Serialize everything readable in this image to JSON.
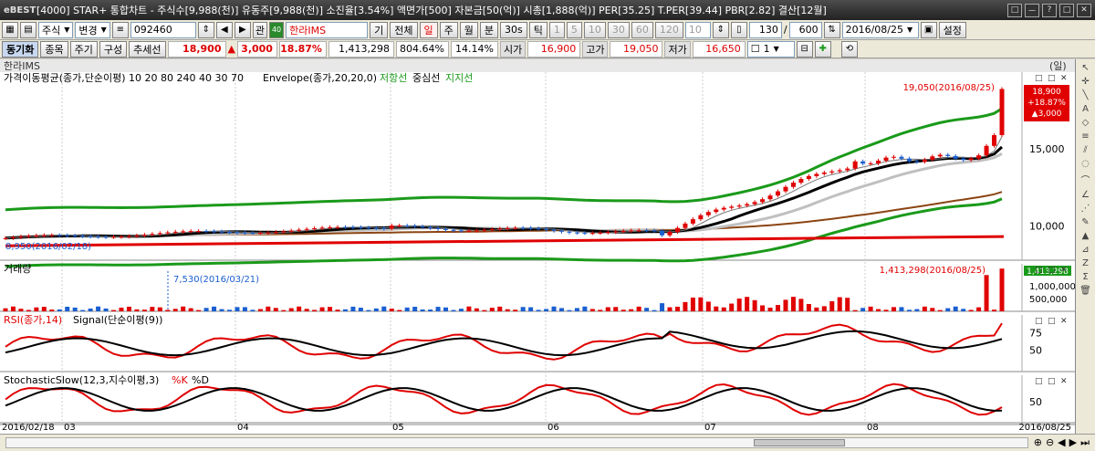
{
  "window": {
    "logo": "eBEST",
    "title": "[4000] STAR+ 통합차트 - 주식수[9,988(천)] 유동주[9,988(천)] 소진율[3.54%] 액면가[500] 자본금[50(억)] 시총[1,888(억)] PER[35.25] T.PER[39.44] PBR[2.82] 결산[12월]",
    "buttons": [
      "□",
      "ㅡ",
      "?",
      "□",
      "✕"
    ]
  },
  "toolbar1": {
    "market": "주식",
    "change": "변경",
    "code": "092460",
    "link": "관",
    "name": "한라IMS",
    "basis": "기",
    "all": "전체",
    "periods": [
      "일",
      "주",
      "월",
      "분",
      "30s",
      "틱"
    ],
    "nums": [
      "1",
      "5",
      "10",
      "30",
      "60",
      "120",
      "10"
    ],
    "count": "130",
    "count_total": "600",
    "date": "2016/08/25",
    "setting": "설정"
  },
  "toolbar2": {
    "sync": "동기화",
    "tab_item": "종목",
    "tab_period": "주기",
    "tab_config": "구성",
    "tab_trend": "추세선",
    "price": "18,900",
    "change_sign": "▲",
    "change": "3,000",
    "rate": "18.87%",
    "volume": "1,413,298",
    "vol_pct": "804.64%",
    "turnover": "14.14%",
    "open_label": "시가",
    "open": "16,900",
    "high_label": "고가",
    "high": "19,050",
    "low_label": "저가",
    "low": "16,650",
    "ratio": "1"
  },
  "chart": {
    "stock_name": "한라IMS",
    "unit": "(일)",
    "colors": {
      "up": "#e00000",
      "down": "#1a5fd0",
      "ma5": "#000000",
      "ma20": "#c0c0c0",
      "ma60": "#8b4513",
      "ma120": "#e00000",
      "envelope": "#1a9a1a",
      "rsi": "#e00000",
      "signal": "#000000"
    },
    "price_panel": {
      "legend": "가격이동평균(종가,단순이평) 10 20 80 240 40 30 70",
      "legend2": "Envelope(종가,20,20,0)",
      "env_low": "저항선",
      "env_mid": "중심선",
      "env_sup": "지지선",
      "high_marker": "19,050(2016/08/25)",
      "low_marker": "8,950(2016/02/18)",
      "last_price": "18,900",
      "last_rate": "+18.87%",
      "last_change": "▲3,000",
      "yticks": [
        "15,000",
        "10,000"
      ]
    },
    "volume_panel": {
      "legend": "거래량",
      "max_marker": "1,413,298(2016/08/25)",
      "min_marker": "7,530(2016/03/21)",
      "last": "1,413,298",
      "yticks": [
        "1,000,000",
        "500,000"
      ]
    },
    "rsi_panel": {
      "legend_rsi": "RSI(종가,14)",
      "legend_signal": "Signal(단순이평(9))",
      "yticks": [
        "75",
        "50"
      ]
    },
    "stoch_panel": {
      "legend": "StochasticSlow(12,3,지수이평,3)",
      "k": "%K",
      "d": "%D",
      "yticks": [
        "50"
      ]
    },
    "panel_ctrl": [
      "□",
      "□",
      "✕"
    ],
    "xaxis": {
      "start": "2016/02/18",
      "labels": [
        "03",
        "04",
        "05",
        "06",
        "07",
        "08"
      ],
      "end": "2016/08/25"
    }
  },
  "statusbar": {
    "zoom_in": "⊕",
    "zoom_out": "⊖"
  }
}
